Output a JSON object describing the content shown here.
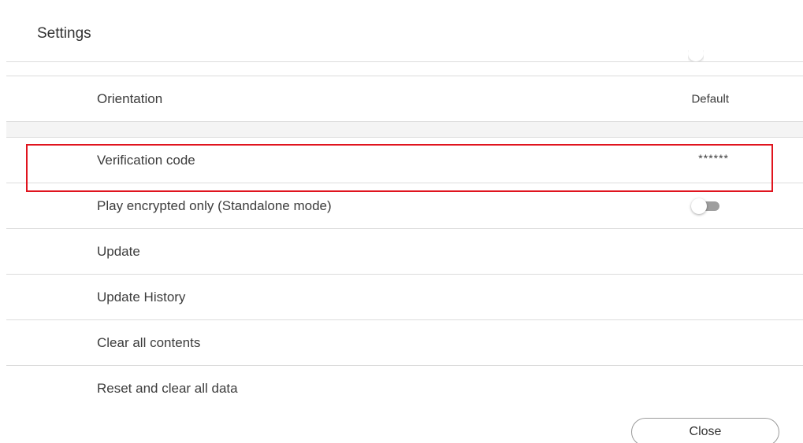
{
  "header": {
    "title": "Settings"
  },
  "settings": {
    "orientation": {
      "label": "Orientation",
      "value": "Default"
    },
    "verification_code": {
      "label": "Verification code",
      "value": "******"
    },
    "play_encrypted_only": {
      "label": "Play encrypted only (Standalone mode)",
      "enabled": false
    },
    "update": {
      "label": "Update"
    },
    "update_history": {
      "label": "Update History"
    },
    "clear_all_contents": {
      "label": "Clear all contents"
    },
    "reset_and_clear": {
      "label": "Reset and clear all data"
    }
  },
  "footer": {
    "close_label": "Close"
  },
  "colors": {
    "highlight": "#e0141e",
    "divider": "#dcdcdc",
    "section_band": "#f4f4f4",
    "toggle_off_track": "#9e9e9e"
  },
  "icons": {
    "toggle": "toggle-switch-icon"
  }
}
